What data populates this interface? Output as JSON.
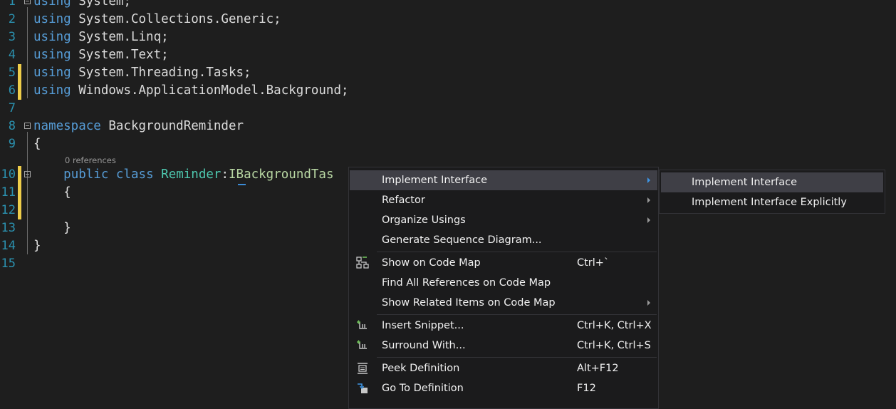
{
  "editor": {
    "codelens_references": "0 references",
    "lines": [
      {
        "num": "1",
        "tokens": [
          {
            "t": "using",
            "c": "kw"
          },
          {
            "t": " System;",
            "c": ""
          }
        ]
      },
      {
        "num": "2",
        "tokens": [
          {
            "t": "using",
            "c": "kw"
          },
          {
            "t": " System.Collections.Generic;",
            "c": ""
          }
        ]
      },
      {
        "num": "3",
        "tokens": [
          {
            "t": "using",
            "c": "kw"
          },
          {
            "t": " System.Linq;",
            "c": ""
          }
        ]
      },
      {
        "num": "4",
        "tokens": [
          {
            "t": "using",
            "c": "kw"
          },
          {
            "t": " System.Text;",
            "c": ""
          }
        ]
      },
      {
        "num": "5",
        "tokens": [
          {
            "t": "using",
            "c": "kw"
          },
          {
            "t": " System.Threading.Tasks;",
            "c": ""
          }
        ]
      },
      {
        "num": "6",
        "tokens": [
          {
            "t": "using",
            "c": "kw"
          },
          {
            "t": " Windows.ApplicationModel.Background;",
            "c": ""
          }
        ]
      },
      {
        "num": "7",
        "tokens": []
      },
      {
        "num": "8",
        "tokens": [
          {
            "t": "namespace",
            "c": "kw"
          },
          {
            "t": " BackgroundReminder",
            "c": ""
          }
        ]
      },
      {
        "num": "9",
        "tokens": [
          {
            "t": "{",
            "c": ""
          }
        ]
      },
      {
        "num": "10",
        "tokens": [
          {
            "t": "    ",
            "c": ""
          },
          {
            "t": "public",
            "c": "kw"
          },
          {
            "t": " ",
            "c": ""
          },
          {
            "t": "class",
            "c": "kw"
          },
          {
            "t": " ",
            "c": ""
          },
          {
            "t": "Reminder",
            "c": "ty"
          },
          {
            "t": ":",
            "c": ""
          },
          {
            "t": "IBackgroundTas",
            "c": "iface"
          }
        ]
      },
      {
        "num": "11",
        "tokens": [
          {
            "t": "    {",
            "c": ""
          }
        ]
      },
      {
        "num": "12",
        "tokens": []
      },
      {
        "num": "13",
        "tokens": [
          {
            "t": "    }",
            "c": ""
          }
        ]
      },
      {
        "num": "14",
        "tokens": [
          {
            "t": "}",
            "c": ""
          }
        ]
      },
      {
        "num": "15",
        "tokens": []
      }
    ]
  },
  "context_menu": {
    "items": [
      {
        "label": "Implement Interface",
        "shortcut": "",
        "submenu": true,
        "highlighted": true,
        "icon": ""
      },
      {
        "label": "Refactor",
        "shortcut": "",
        "submenu": true,
        "icon": ""
      },
      {
        "label": "Organize Usings",
        "shortcut": "",
        "submenu": true,
        "icon": ""
      },
      {
        "label": "Generate Sequence Diagram...",
        "shortcut": "",
        "submenu": false,
        "icon": ""
      },
      {
        "separator": true
      },
      {
        "label": "Show on Code Map",
        "shortcut": "Ctrl+`",
        "submenu": false,
        "icon": "code-map-icon"
      },
      {
        "label": "Find All References on Code Map",
        "shortcut": "",
        "submenu": false,
        "icon": ""
      },
      {
        "label": "Show Related Items on Code Map",
        "shortcut": "",
        "submenu": true,
        "icon": ""
      },
      {
        "separator": true
      },
      {
        "label": "Insert Snippet...",
        "shortcut": "Ctrl+K, Ctrl+X",
        "submenu": false,
        "icon": "insert-snippet-icon"
      },
      {
        "label": "Surround With...",
        "shortcut": "Ctrl+K, Ctrl+S",
        "submenu": false,
        "icon": "surround-with-icon"
      },
      {
        "separator": true
      },
      {
        "label": "Peek Definition",
        "shortcut": "Alt+F12",
        "submenu": false,
        "icon": "peek-definition-icon"
      },
      {
        "label": "Go To Definition",
        "shortcut": "F12",
        "submenu": false,
        "icon": "go-to-definition-icon"
      }
    ]
  },
  "submenu": {
    "items": [
      {
        "label": "Implement Interface",
        "highlighted": true
      },
      {
        "label": "Implement Interface Explicitly",
        "highlighted": false
      }
    ]
  },
  "colors": {
    "background": "#1e1e1e",
    "line_number": "#2b91af",
    "keyword": "#569cd6",
    "type": "#4ec9b0",
    "interface": "#b8d7a3",
    "change_marker": "#efce4a",
    "menu_bg": "#1b1b1c",
    "menu_highlight": "#3f3f46"
  }
}
